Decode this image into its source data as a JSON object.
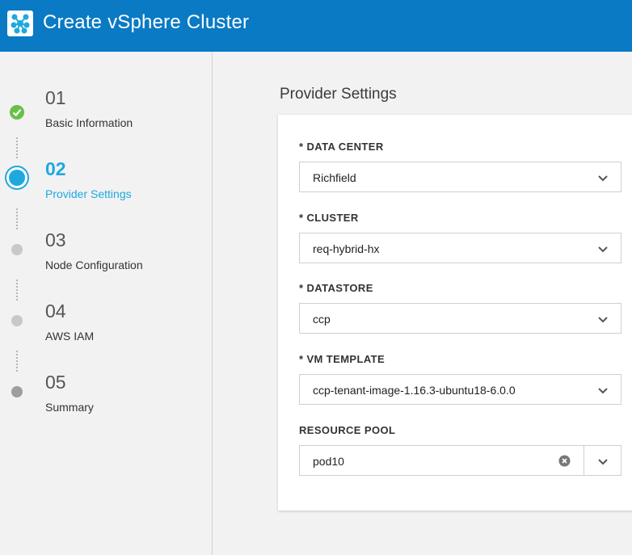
{
  "header": {
    "title": "Create vSphere Cluster",
    "logo_icon": "cluster-network-icon"
  },
  "steps": [
    {
      "number": "01",
      "label": "Basic Information",
      "status": "complete"
    },
    {
      "number": "02",
      "label": "Provider Settings",
      "status": "active"
    },
    {
      "number": "03",
      "label": "Node Configuration",
      "status": "pending"
    },
    {
      "number": "04",
      "label": "AWS IAM",
      "status": "pending"
    },
    {
      "number": "05",
      "label": "Summary",
      "status": "pending"
    }
  ],
  "panel": {
    "title": "Provider Settings",
    "fields": [
      {
        "label": "* DATA CENTER",
        "value": "Richfield"
      },
      {
        "label": "* CLUSTER",
        "value": "req-hybrid-hx"
      },
      {
        "label": "* DATASTORE",
        "value": "ccp"
      },
      {
        "label": "* VM TEMPLATE",
        "value": "ccp-tenant-image-1.16.3-ubuntu18-6.0.0"
      },
      {
        "label": "RESOURCE POOL",
        "value": "pod10"
      }
    ]
  },
  "colors": {
    "header": "#0a7ac4",
    "active": "#1ea8e0",
    "complete": "#6abf4b",
    "pending": "#c8c8c8"
  }
}
